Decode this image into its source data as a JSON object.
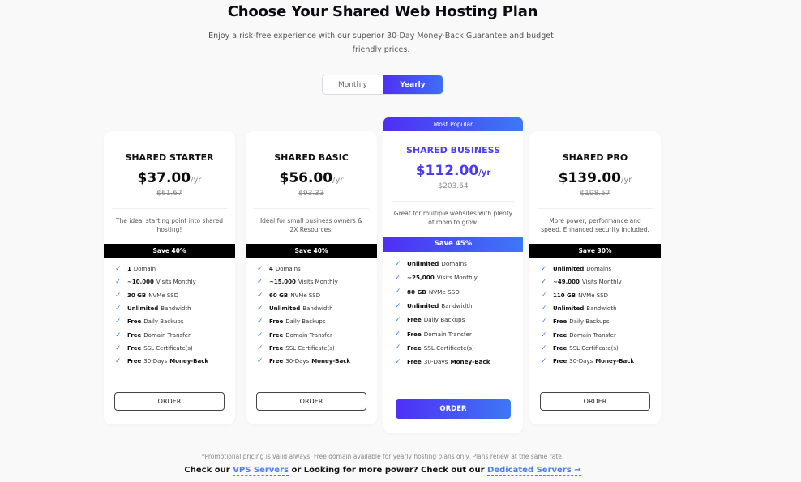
{
  "header": {
    "title": "Choose Your Shared Web Hosting Plan",
    "subtitle": "Enjoy a risk-free experience with our superior 30-Day Money-Back Guarantee and budget friendly prices."
  },
  "billing_toggle": {
    "options": [
      "Monthly",
      "Yearly"
    ],
    "selected": "Yearly"
  },
  "plans": [
    {
      "name": "SHARED STARTER",
      "price": "$37.00",
      "period": "/yr",
      "old_price": "$61.67",
      "description": "The ideal starting point into shared hosting!",
      "save": "Save 40%",
      "features": [
        {
          "bold": "1",
          "text": "Domain"
        },
        {
          "bold": "~10,000",
          "text": "Visits Monthly"
        },
        {
          "bold": "30 GB",
          "text": "NVMe SSD"
        },
        {
          "bold": "Unlimited",
          "text": "Bandwidth"
        },
        {
          "bold": "Free",
          "text": "Daily Backups"
        },
        {
          "bold": "Free",
          "text": "Domain Transfer"
        },
        {
          "bold": "Free",
          "text": "SSL Certificate(s)"
        },
        {
          "bold": "Free",
          "text": "30-Days",
          "bold2": "Money-Back"
        }
      ],
      "order_label": "ORDER"
    },
    {
      "name": "SHARED BASIC",
      "price": "$56.00",
      "period": "/yr",
      "old_price": "$93.33",
      "description": "Ideal for small business owners & 2X Resources.",
      "save": "Save 40%",
      "features": [
        {
          "bold": "4",
          "text": "Domains"
        },
        {
          "bold": "~15,000",
          "text": "Visits Monthly"
        },
        {
          "bold": "60 GB",
          "text": "NVMe SSD"
        },
        {
          "bold": "Unlimited",
          "text": "Bandwidth"
        },
        {
          "bold": "Free",
          "text": "Daily Backups"
        },
        {
          "bold": "Free",
          "text": "Domain Transfer"
        },
        {
          "bold": "Free",
          "text": "SSL Certificate(s)"
        },
        {
          "bold": "Free",
          "text": "30-Days",
          "bold2": "Money-Back"
        }
      ],
      "order_label": "ORDER"
    },
    {
      "badge": "Most Popular",
      "name": "SHARED BUSINESS",
      "price": "$112.00",
      "period": "/yr",
      "old_price": "$203.64",
      "description": "Great for multiple websites with plenty of room to grow.",
      "save": "Save 45%",
      "features": [
        {
          "bold": "Unlimited",
          "text": "Domains"
        },
        {
          "bold": "~25,000",
          "text": "Visits Monthly"
        },
        {
          "bold": "80 GB",
          "text": "NVMe SSD"
        },
        {
          "bold": "Unlimited",
          "text": "Bandwidth"
        },
        {
          "bold": "Free",
          "text": "Daily Backups"
        },
        {
          "bold": "Free",
          "text": "Domain Transfer"
        },
        {
          "bold": "Free",
          "text": "SSL Certificate(s)"
        },
        {
          "bold": "Free",
          "text": "30-Days",
          "bold2": "Money-Back"
        }
      ],
      "order_label": "ORDER"
    },
    {
      "name": "SHARED PRO",
      "price": "$139.00",
      "period": "/yr",
      "old_price": "$198.57",
      "description": "More power, performance and speed. Enhanced security included.",
      "save": "Save 30%",
      "features": [
        {
          "bold": "Unlimited",
          "text": "Domains"
        },
        {
          "bold": "~49,000",
          "text": "Visits Monthly"
        },
        {
          "bold": "110 GB",
          "text": "NVMe SSD"
        },
        {
          "bold": "Unlimited",
          "text": "Bandwidth"
        },
        {
          "bold": "Free",
          "text": "Daily Backups"
        },
        {
          "bold": "Free",
          "text": "Domain Transfer"
        },
        {
          "bold": "Free",
          "text": "SSL Certificate(s)"
        },
        {
          "bold": "Free",
          "text": "30-Days",
          "bold2": "Money-Back"
        }
      ],
      "order_label": "ORDER"
    }
  ],
  "footer": {
    "note": "*Promotional pricing is valid always. Free domain available for yearly hosting plans only. Plans renew at the same rate.",
    "text1": "Check our ",
    "link1": "VPS Servers",
    "text2": " or Looking for more power? Check out our ",
    "link2": "Dedicated Servers →"
  },
  "colors": {
    "accent": "#4a3df0",
    "gradient_start": "#4f2ff5",
    "gradient_end": "#3e78f5",
    "check": "#3b82f6",
    "link": "#4a7ef0"
  }
}
